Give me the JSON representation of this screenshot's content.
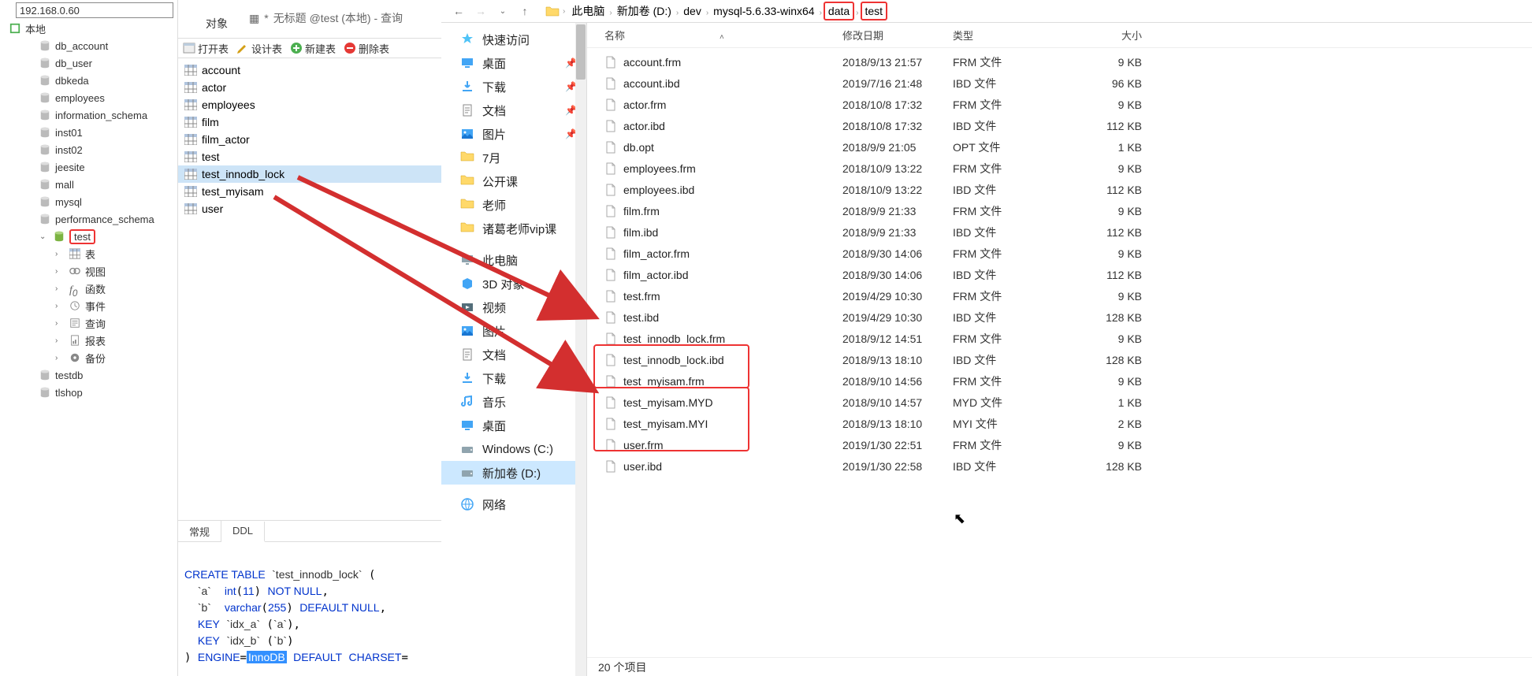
{
  "addr": "192.168.0.60",
  "root_label": "本地",
  "tree_dbs": [
    "db_account",
    "db_user",
    "dbkeda",
    "employees",
    "information_schema",
    "inst01",
    "inst02",
    "jeesite",
    "mall",
    "mysql",
    "performance_schema"
  ],
  "tree_selected": "test",
  "tree_sub": [
    {
      "label": "表",
      "icon": "table"
    },
    {
      "label": "视图",
      "icon": "view"
    },
    {
      "label": "函数",
      "icon": "fx"
    },
    {
      "label": "事件",
      "icon": "event"
    },
    {
      "label": "查询",
      "icon": "query"
    },
    {
      "label": "报表",
      "icon": "report"
    },
    {
      "label": "备份",
      "icon": "backup"
    }
  ],
  "tree_dbs2": [
    "testdb",
    "tlshop"
  ],
  "obj_label": "对象",
  "tab_title": "无标题 @test (本地) - 查询",
  "toolbar": {
    "open": "打开表",
    "design": "设计表",
    "new": "新建表",
    "delete": "删除表"
  },
  "tables": [
    "account",
    "actor",
    "employees",
    "film",
    "film_actor",
    "test",
    "test_innodb_lock",
    "test_myisam",
    "user"
  ],
  "table_selected_idx": 6,
  "bottom_tabs": {
    "general": "常规",
    "ddl": "DDL"
  },
  "ddl": {
    "l1a": "CREATE TABLE",
    "l1b": "`test_innodb_lock`",
    "l2a": "`a`",
    "l2b": "int",
    "l2c": "11",
    "l2d": "NOT NULL",
    "l3a": "`b`",
    "l3b": "varchar",
    "l3c": "255",
    "l3d": "DEFAULT NULL",
    "l4a": "KEY",
    "l4b": "`idx_a`",
    "l4c": "`a`",
    "l5a": "KEY",
    "l5b": "`idx_b`",
    "l5c": "`b`",
    "l6a": "ENGINE",
    "l6b": "InnoDB",
    "l6c": "DEFAULT",
    "l6d": "CHARSET"
  },
  "breadcrumb": [
    "此电脑",
    "新加卷 (D:)",
    "dev",
    "mysql-5.6.33-winx64",
    "data",
    "test"
  ],
  "nav_items": [
    {
      "label": "快速访问",
      "icon": "star",
      "pin": false
    },
    {
      "label": "桌面",
      "icon": "desktop",
      "pin": true
    },
    {
      "label": "下载",
      "icon": "download",
      "pin": true
    },
    {
      "label": "文档",
      "icon": "doc",
      "pin": true
    },
    {
      "label": "图片",
      "icon": "pic",
      "pin": true
    },
    {
      "label": "7月",
      "icon": "folder",
      "pin": false
    },
    {
      "label": "公开课",
      "icon": "folder",
      "pin": false
    },
    {
      "label": "老师",
      "icon": "folder",
      "pin": false
    },
    {
      "label": "诸葛老师vip课",
      "icon": "folder",
      "pin": false
    },
    {
      "label": "此电脑",
      "icon": "pc",
      "pin": false,
      "blank_before": true
    },
    {
      "label": "3D 对象",
      "icon": "3d",
      "pin": false
    },
    {
      "label": "视频",
      "icon": "video",
      "pin": false
    },
    {
      "label": "图片",
      "icon": "pic",
      "pin": false
    },
    {
      "label": "文档",
      "icon": "doc",
      "pin": false
    },
    {
      "label": "下载",
      "icon": "download",
      "pin": false
    },
    {
      "label": "音乐",
      "icon": "music",
      "pin": false
    },
    {
      "label": "桌面",
      "icon": "desktop",
      "pin": false
    },
    {
      "label": "Windows (C:)",
      "icon": "drive",
      "pin": false
    },
    {
      "label": "新加卷 (D:)",
      "icon": "drive",
      "pin": false,
      "sel": true
    },
    {
      "label": "网络",
      "icon": "net",
      "pin": false,
      "blank_before": true
    }
  ],
  "columns": {
    "name": "名称",
    "date": "修改日期",
    "type": "类型",
    "size": "大小"
  },
  "files": [
    {
      "name": "account.frm",
      "date": "2018/9/13 21:57",
      "type": "FRM 文件",
      "size": "9 KB"
    },
    {
      "name": "account.ibd",
      "date": "2019/7/16 21:48",
      "type": "IBD 文件",
      "size": "96 KB"
    },
    {
      "name": "actor.frm",
      "date": "2018/10/8 17:32",
      "type": "FRM 文件",
      "size": "9 KB"
    },
    {
      "name": "actor.ibd",
      "date": "2018/10/8 17:32",
      "type": "IBD 文件",
      "size": "112 KB"
    },
    {
      "name": "db.opt",
      "date": "2018/9/9 21:05",
      "type": "OPT 文件",
      "size": "1 KB"
    },
    {
      "name": "employees.frm",
      "date": "2018/10/9 13:22",
      "type": "FRM 文件",
      "size": "9 KB"
    },
    {
      "name": "employees.ibd",
      "date": "2018/10/9 13:22",
      "type": "IBD 文件",
      "size": "112 KB"
    },
    {
      "name": "film.frm",
      "date": "2018/9/9 21:33",
      "type": "FRM 文件",
      "size": "9 KB"
    },
    {
      "name": "film.ibd",
      "date": "2018/9/9 21:33",
      "type": "IBD 文件",
      "size": "112 KB"
    },
    {
      "name": "film_actor.frm",
      "date": "2018/9/30 14:06",
      "type": "FRM 文件",
      "size": "9 KB"
    },
    {
      "name": "film_actor.ibd",
      "date": "2018/9/30 14:06",
      "type": "IBD 文件",
      "size": "112 KB"
    },
    {
      "name": "test.frm",
      "date": "2019/4/29 10:30",
      "type": "FRM 文件",
      "size": "9 KB"
    },
    {
      "name": "test.ibd",
      "date": "2019/4/29 10:30",
      "type": "IBD 文件",
      "size": "128 KB"
    },
    {
      "name": "test_innodb_lock.frm",
      "date": "2018/9/12 14:51",
      "type": "FRM 文件",
      "size": "9 KB"
    },
    {
      "name": "test_innodb_lock.ibd",
      "date": "2018/9/13 18:10",
      "type": "IBD 文件",
      "size": "128 KB"
    },
    {
      "name": "test_myisam.frm",
      "date": "2018/9/10 14:56",
      "type": "FRM 文件",
      "size": "9 KB"
    },
    {
      "name": "test_myisam.MYD",
      "date": "2018/9/10 14:57",
      "type": "MYD 文件",
      "size": "1 KB"
    },
    {
      "name": "test_myisam.MYI",
      "date": "2018/9/13 18:10",
      "type": "MYI 文件",
      "size": "2 KB"
    },
    {
      "name": "user.frm",
      "date": "2019/1/30 22:51",
      "type": "FRM 文件",
      "size": "9 KB"
    },
    {
      "name": "user.ibd",
      "date": "2019/1/30 22:58",
      "type": "IBD 文件",
      "size": "128 KB"
    }
  ],
  "status": "20 个项目"
}
